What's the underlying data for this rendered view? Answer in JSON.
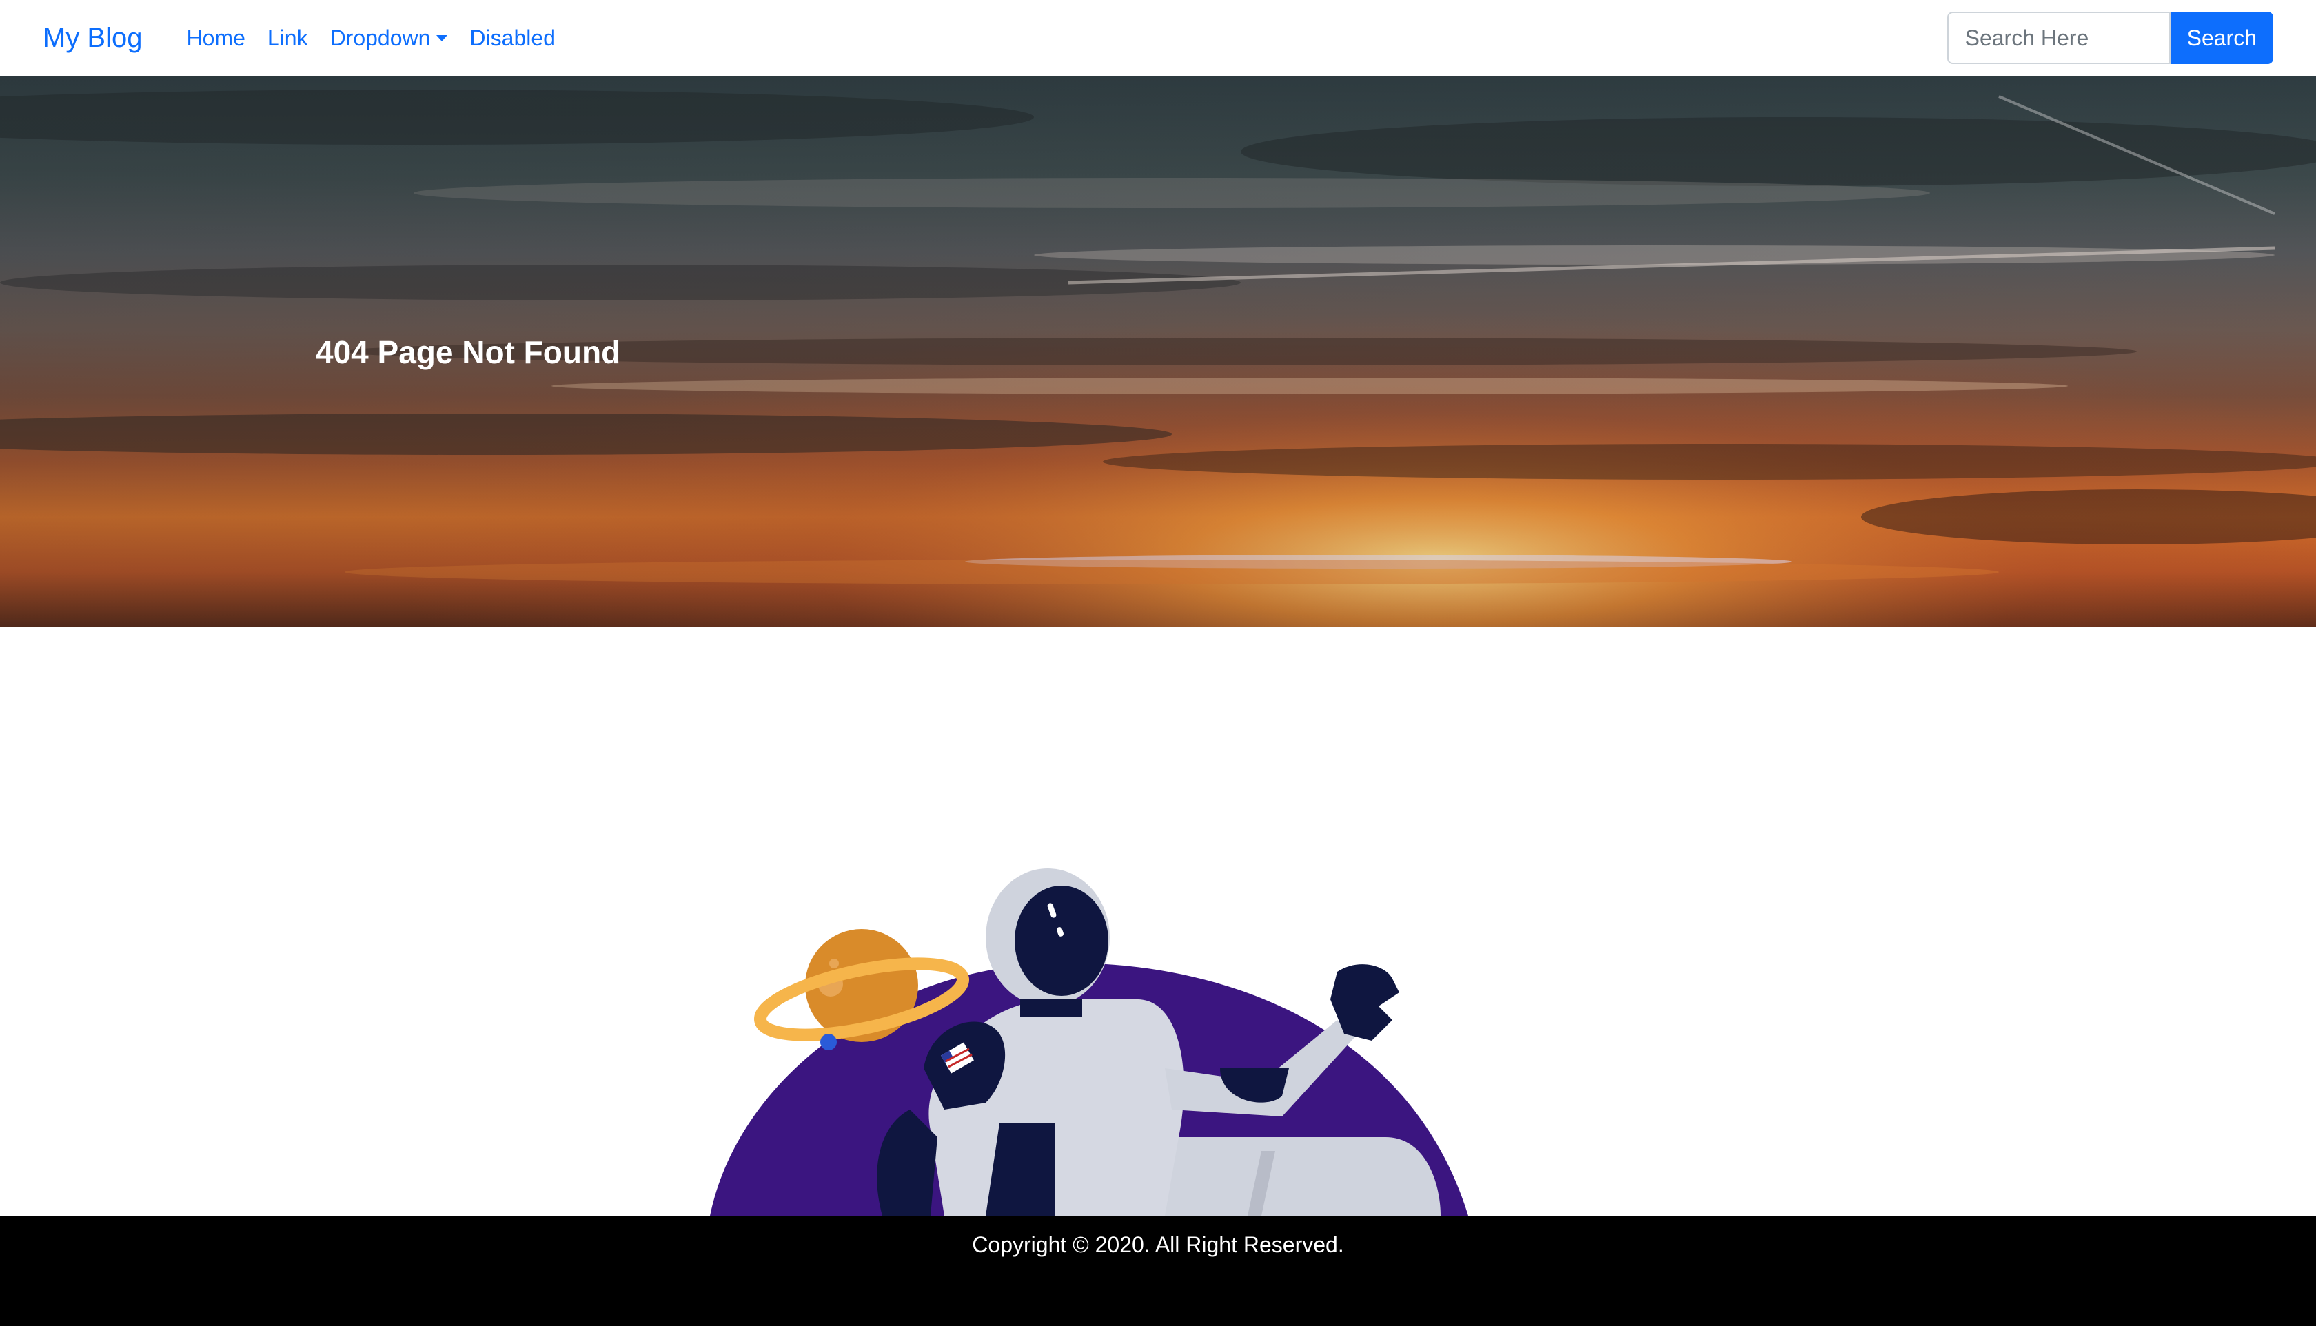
{
  "navbar": {
    "brand": "My Blog",
    "links": [
      {
        "label": "Home"
      },
      {
        "label": "Link"
      },
      {
        "label": "Dropdown"
      },
      {
        "label": "Disabled"
      }
    ],
    "search": {
      "placeholder": "Search Here",
      "value": "",
      "button_label": "Search"
    }
  },
  "hero": {
    "title": "404 Page Not Found"
  },
  "illustration": {
    "icons": [
      "astronaut-icon",
      "planet-icon",
      "flag-patch-icon"
    ]
  },
  "footer": {
    "copyright": "Copyright © 2020. All Right Reserved."
  },
  "colors": {
    "accent": "#0d6efd",
    "footer_bg": "#000000",
    "blob": "#3b1580",
    "planet": "#d98b2a",
    "planet_ring": "#f6b54b",
    "suit_dark": "#0f1640",
    "suit_light": "#cfd3dd"
  }
}
